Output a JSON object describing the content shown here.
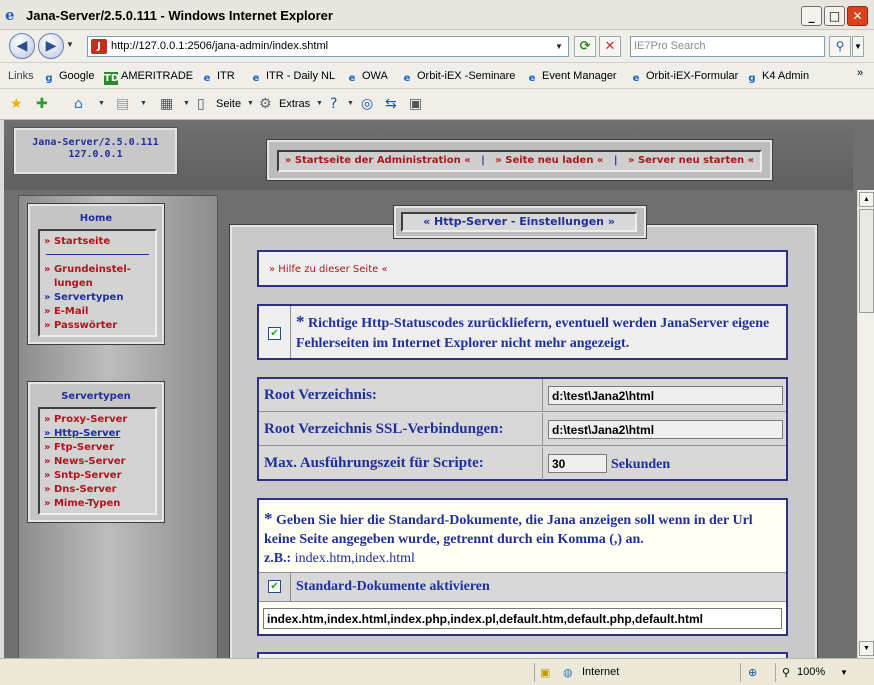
{
  "window": {
    "title": "Jana-Server/2.5.0.111 - Windows Internet Explorer",
    "btn_min": "_",
    "btn_max": "□",
    "btn_close": "✕"
  },
  "address": {
    "url": "http://127.0.0.1:2506/jana-admin/index.shtml",
    "search_placeholder": "IE7Pro Search"
  },
  "links": {
    "label": "Links",
    "items": [
      "Google",
      "AMERITRADE",
      "ITR",
      "ITR - Daily NL",
      "OWA",
      "Orbit-iEX -Seminare",
      "Event Manager",
      "Orbit-iEX-Formular",
      "K4 Admin"
    ],
    "more": "»"
  },
  "command": {
    "page": "Seite",
    "extras": "Extras"
  },
  "server_box": {
    "line1": "Jana-Server/2.5.0.111",
    "line2": "127.0.0.1"
  },
  "top_nav": {
    "items": [
      "» Startseite der Administration «",
      "» Seite neu laden «",
      "» Server neu starten «"
    ],
    "divider": "|"
  },
  "home_menu": {
    "title": "Home",
    "items": [
      "» Startseite",
      "» Grundeinstel-",
      "lungen",
      "» Servertypen",
      "» E-Mail",
      "» Passwörter"
    ]
  },
  "servertypes_menu": {
    "title": "Servertypen",
    "items": [
      "» Proxy-Server",
      "» Http-Server",
      "» Ftp-Server",
      "» News-Server",
      "» Sntp-Server",
      "» Dns-Server",
      "» Mime-Typen"
    ]
  },
  "main": {
    "title": "« Http-Server - Einstellungen »",
    "help_link": "» Hilfe zu dieser Seite «",
    "statuscodes_star": "*",
    "statuscodes_text": "Richtige Http-Statuscodes zurückliefern, eventuell werden JanaServer eigene Fehlerseiten im Internet Explorer nicht mehr angezeigt.",
    "statuscodes_checked": true,
    "root_label": "Root Verzeichnis:",
    "root_value": "d:\\test\\Jana2\\html",
    "ssl_label": "Root Verzeichnis SSL-Verbindungen:",
    "ssl_value": "d:\\test\\Jana2\\html",
    "maxtime_label": "Max. Ausführungszeit für Scripte:",
    "maxtime_value": "30",
    "maxtime_unit": "Sekunden",
    "stddocs_star": "*",
    "stddocs_text": "Geben Sie hier die Standard-Dokumente, die Jana anzeigen soll wenn in der Url keine Seite angegeben wurde, getrennt durch ein Komma (,) an.",
    "stddocs_example_label": "z.B.:",
    "stddocs_example": "index.htm,index.html",
    "stddocs_enable_label": "Standard-Dokumente aktivieren",
    "stddocs_enabled": true,
    "stddocs_value": "index.htm,index.html,index.php,index.pl,default.htm,default.php,default.html"
  },
  "status": {
    "zone": "Internet",
    "zoom": "100%"
  }
}
